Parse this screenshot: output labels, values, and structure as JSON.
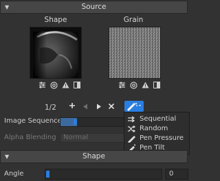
{
  "source_section": {
    "title": "Source"
  },
  "shape_image": {
    "label": "Shape"
  },
  "grain_image": {
    "label": "Grain"
  },
  "image_icons": [
    "sliders-icon",
    "at-icon",
    "warning-icon",
    "book-icon"
  ],
  "sequence_nav": {
    "counter": "1/2"
  },
  "image_sequence": {
    "label": "Image Sequence",
    "progress": 0.25
  },
  "alpha_blending": {
    "label": "Alpha Blending",
    "value": "Normal"
  },
  "mode_menu": {
    "items": [
      {
        "icon": "arrows-right-icon",
        "label": "Sequential"
      },
      {
        "icon": "shuffle-icon",
        "label": "Random"
      },
      {
        "icon": "pen-icon",
        "label": "Pen Pressure"
      },
      {
        "icon": "pen-tilt-icon",
        "label": "Pen Tilt"
      }
    ]
  },
  "shape_section": {
    "title": "Shape"
  },
  "angle": {
    "label": "Angle",
    "value": "0"
  },
  "colors": {
    "accent": "#2a7ee0",
    "background": "#323232",
    "header": "#464646"
  }
}
